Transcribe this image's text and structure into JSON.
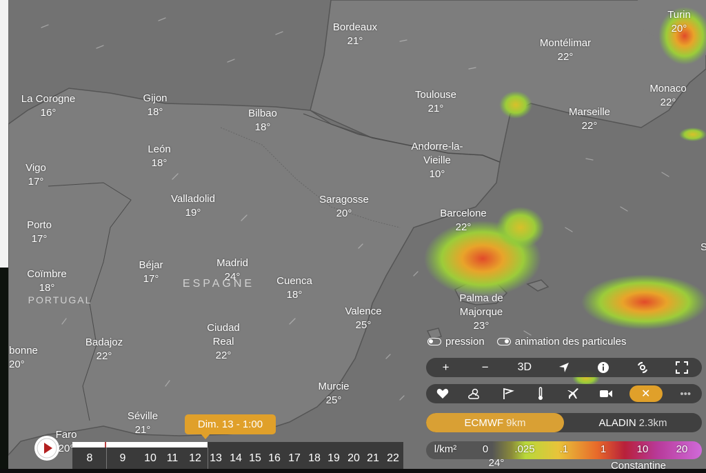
{
  "cities": [
    {
      "name": "Bordeaux",
      "temp": "21°"
    },
    {
      "name": "Montélimar",
      "temp": "22°"
    },
    {
      "name": "Turin",
      "temp": "20°"
    },
    {
      "name": "Toulouse",
      "temp": "21°"
    },
    {
      "name": "Monaco",
      "temp": "22°"
    },
    {
      "name": "Marseille",
      "temp": "22°"
    },
    {
      "name": "La Corogne",
      "temp": "16°"
    },
    {
      "name": "Gijon",
      "temp": "18°"
    },
    {
      "name": "Bilbao",
      "temp": "18°"
    },
    {
      "name": "León",
      "temp": "18°"
    },
    {
      "name": "Andorre-la-Vieille",
      "temp": "10°"
    },
    {
      "name": "Vigo",
      "temp": "17°"
    },
    {
      "name": "Valladolid",
      "temp": "19°"
    },
    {
      "name": "Saragosse",
      "temp": "20°"
    },
    {
      "name": "Barcelone",
      "temp": "22°"
    },
    {
      "name": "Porto",
      "temp": "17°"
    },
    {
      "name": "Béjar",
      "temp": "17°"
    },
    {
      "name": "Madrid",
      "temp": "24°"
    },
    {
      "name": "Coïmbre",
      "temp": "18°"
    },
    {
      "name": "Cuenca",
      "temp": "18°"
    },
    {
      "name": "Palma de Majorque",
      "temp": "23°"
    },
    {
      "name": "Valence",
      "temp": "25°"
    },
    {
      "name": "Ciudad Real",
      "temp": "22°"
    },
    {
      "name": "Badajoz",
      "temp": "22°"
    },
    {
      "name": "Lisbonne",
      "temp": "20°"
    },
    {
      "name": "Murcie",
      "temp": "25°"
    },
    {
      "name": "Séville",
      "temp": "21°"
    },
    {
      "name": "Faro",
      "temp": "20°"
    },
    {
      "name": "Sa",
      "temp": ""
    },
    {
      "name": "Constantine",
      "temp": "24°"
    }
  ],
  "countries": {
    "spain": "ESPAGNE",
    "portugal": "PORTUGAL"
  },
  "toggles": {
    "pressure": "pression",
    "particles": "animation des particules"
  },
  "controls": {
    "zoom_in": "+",
    "zoom_out": "−",
    "three_d": "3D"
  },
  "actions": {
    "favorite_icon": "heart-icon",
    "weather_icon": "cloud-sun-icon",
    "flag_icon": "flag-icon",
    "thermometer_icon": "thermometer-icon",
    "plane_icon": "plane-icon",
    "camera_icon": "video-camera-icon",
    "close": "✕",
    "more": "•••"
  },
  "models": [
    {
      "name": "ECMWF",
      "res": "9km",
      "active": true
    },
    {
      "name": "ALADIN",
      "res": "2.3km",
      "active": false
    }
  ],
  "legend": {
    "unit": "l/km²",
    "values": [
      "0",
      ".025",
      ".1",
      "1",
      "10",
      "20"
    ]
  },
  "timeline": {
    "tooltip": "Dim. 13 - 1:00",
    "hours": [
      "8",
      "9",
      "10",
      "11",
      "12",
      "13",
      "14",
      "15",
      "16",
      "17",
      "18",
      "19",
      "20",
      "21",
      "22"
    ]
  },
  "colors": {
    "accent": "#e0a02a",
    "map_land": "#7c7c7c",
    "map_sea": "#6f6f6f",
    "rain_green": "#86c83a",
    "rain_orange": "#e8642a"
  }
}
